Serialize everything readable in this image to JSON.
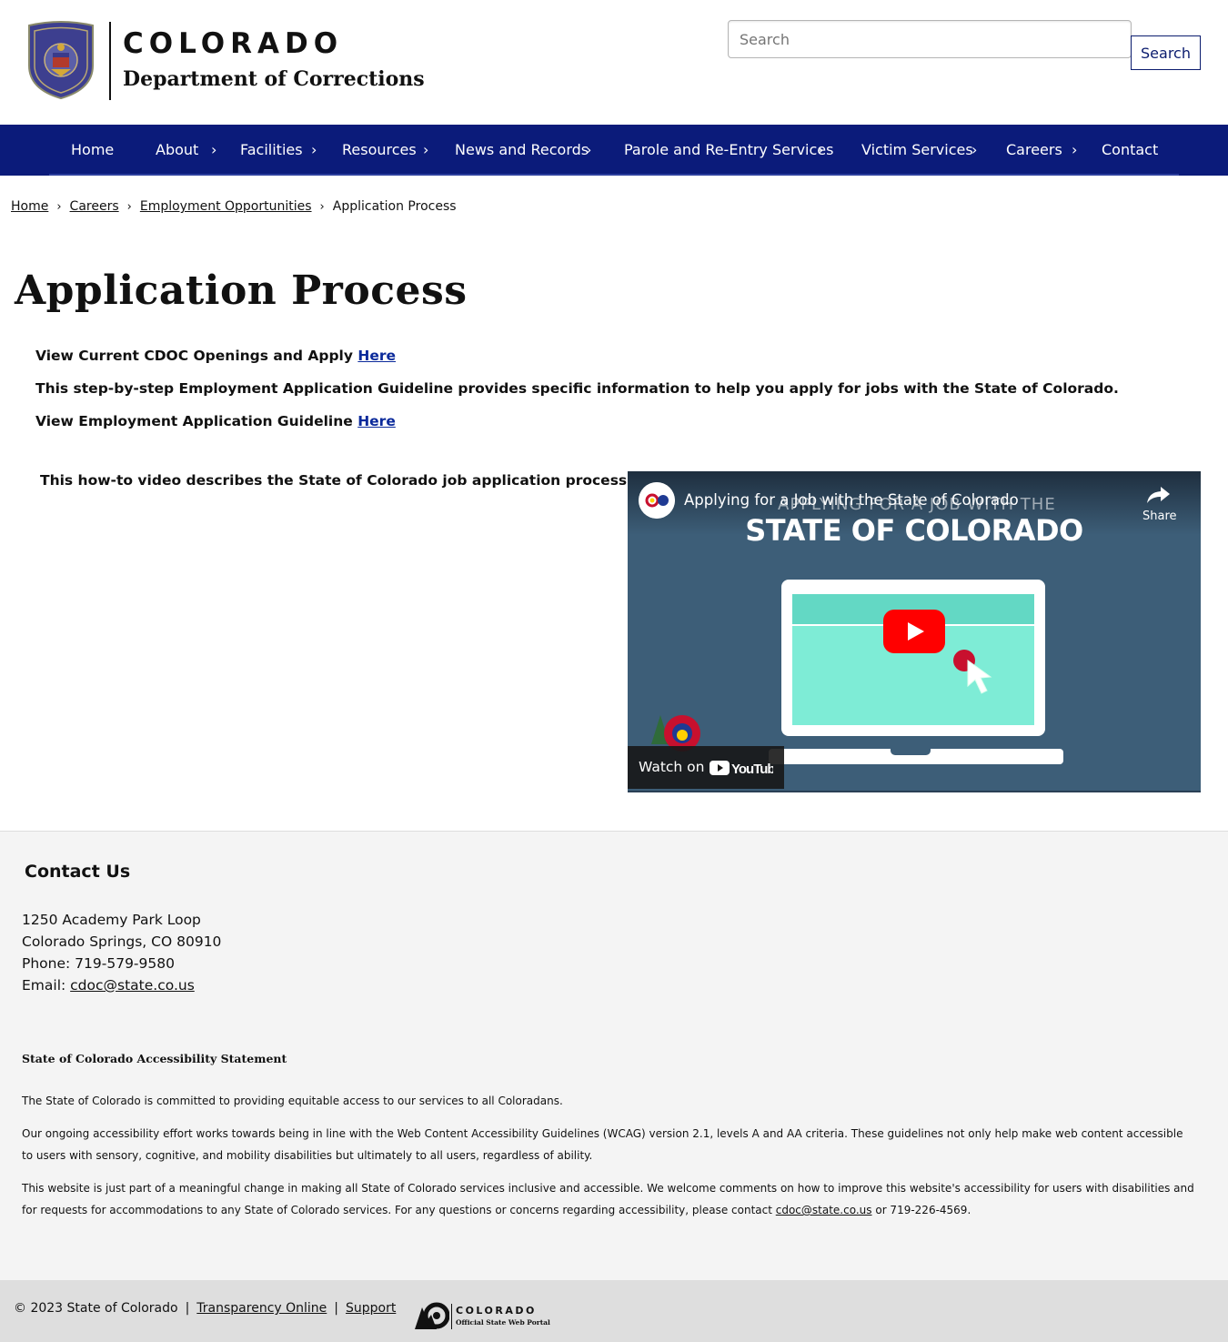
{
  "header": {
    "state_name": "COLORADO",
    "department": "Department of Corrections",
    "search_placeholder": "Search",
    "search_button": "Search"
  },
  "nav": {
    "items": [
      {
        "label": "Home",
        "has_submenu": false
      },
      {
        "label": "About",
        "has_submenu": true
      },
      {
        "label": "Facilities",
        "has_submenu": true
      },
      {
        "label": "Resources",
        "has_submenu": true
      },
      {
        "label": "News and Records",
        "has_submenu": true
      },
      {
        "label": "Parole and Re-Entry Services",
        "has_submenu": true
      },
      {
        "label": "Victim Services",
        "has_submenu": true
      },
      {
        "label": "Careers",
        "has_submenu": true
      },
      {
        "label": "Contact",
        "has_submenu": false
      }
    ],
    "chevron": "›"
  },
  "breadcrumb": {
    "items": [
      "Home",
      "Careers",
      "Employment Opportunities"
    ],
    "current": "Application Process",
    "separator": "›"
  },
  "main": {
    "title": "Application Process",
    "openings_text": "View Current CDOC Openings and Apply ",
    "openings_link": "Here",
    "guideline_intro": "This step-by-step Employment Application Guideline provides specific information to help you apply for jobs with the State of Colorado.",
    "guideline_text": "View Employment Application Guideline ",
    "guideline_link": "Here",
    "video_caption": "This how-to video describes the State of Colorado job application process."
  },
  "video": {
    "title": "Applying for a Job with the State of Colorado",
    "overlay_text": "APPLYING FOR A JOB WITH THE",
    "big_text": "STATE OF COLORADO",
    "share_label": "Share",
    "watch_on": "Watch on",
    "youtube_label": "YouTube",
    "colors": {
      "background": "#3d5e78",
      "screen": "#7eecd6",
      "play": "#ff0000"
    }
  },
  "footer": {
    "contact_heading": "Contact Us",
    "address_line1": "1250 Academy Park Loop",
    "address_line2": "Colorado Springs, CO 80910",
    "phone": "Phone: 719-579-9580",
    "email_label": "Email: ",
    "email": "cdoc@state.co.us",
    "a11y_heading": "State of Colorado Accessibility Statement",
    "a11y_para1": "The State of Colorado is committed to providing equitable access to our services to all Coloradans.",
    "a11y_para2": "Our ongoing accessibility effort works towards being in line with the Web Content Accessibility Guidelines (WCAG) version 2.1, levels A and AA criteria. These guidelines not only help make web content accessible to users with sensory, cognitive, and mobility disabilities but ultimately to all users, regardless of ability.",
    "a11y_para3_before": "This website is just part of a meaningful change in making all State of Colorado services inclusive and accessible. We welcome comments on how to improve this website's accessibility for users with disabilities and for requests for accommodations to any State of Colorado services. For any questions or concerns regarding accessibility, please contact ",
    "a11y_email": "cdoc@state.co.us",
    "a11y_para3_after": " or 719-226-4569."
  },
  "bottom_bar": {
    "copyright": "© 2023 State of Colorado",
    "separator": "|",
    "transparency": "Transparency Online",
    "support": "Support",
    "portal_name": "COLORADO",
    "portal_sub": "Official State Web Portal"
  },
  "colors": {
    "nav_background": "#0b1b7a",
    "link": "#0b2a9b",
    "footer_background": "#f4f4f4",
    "bottom_bar_background": "#dedede"
  }
}
